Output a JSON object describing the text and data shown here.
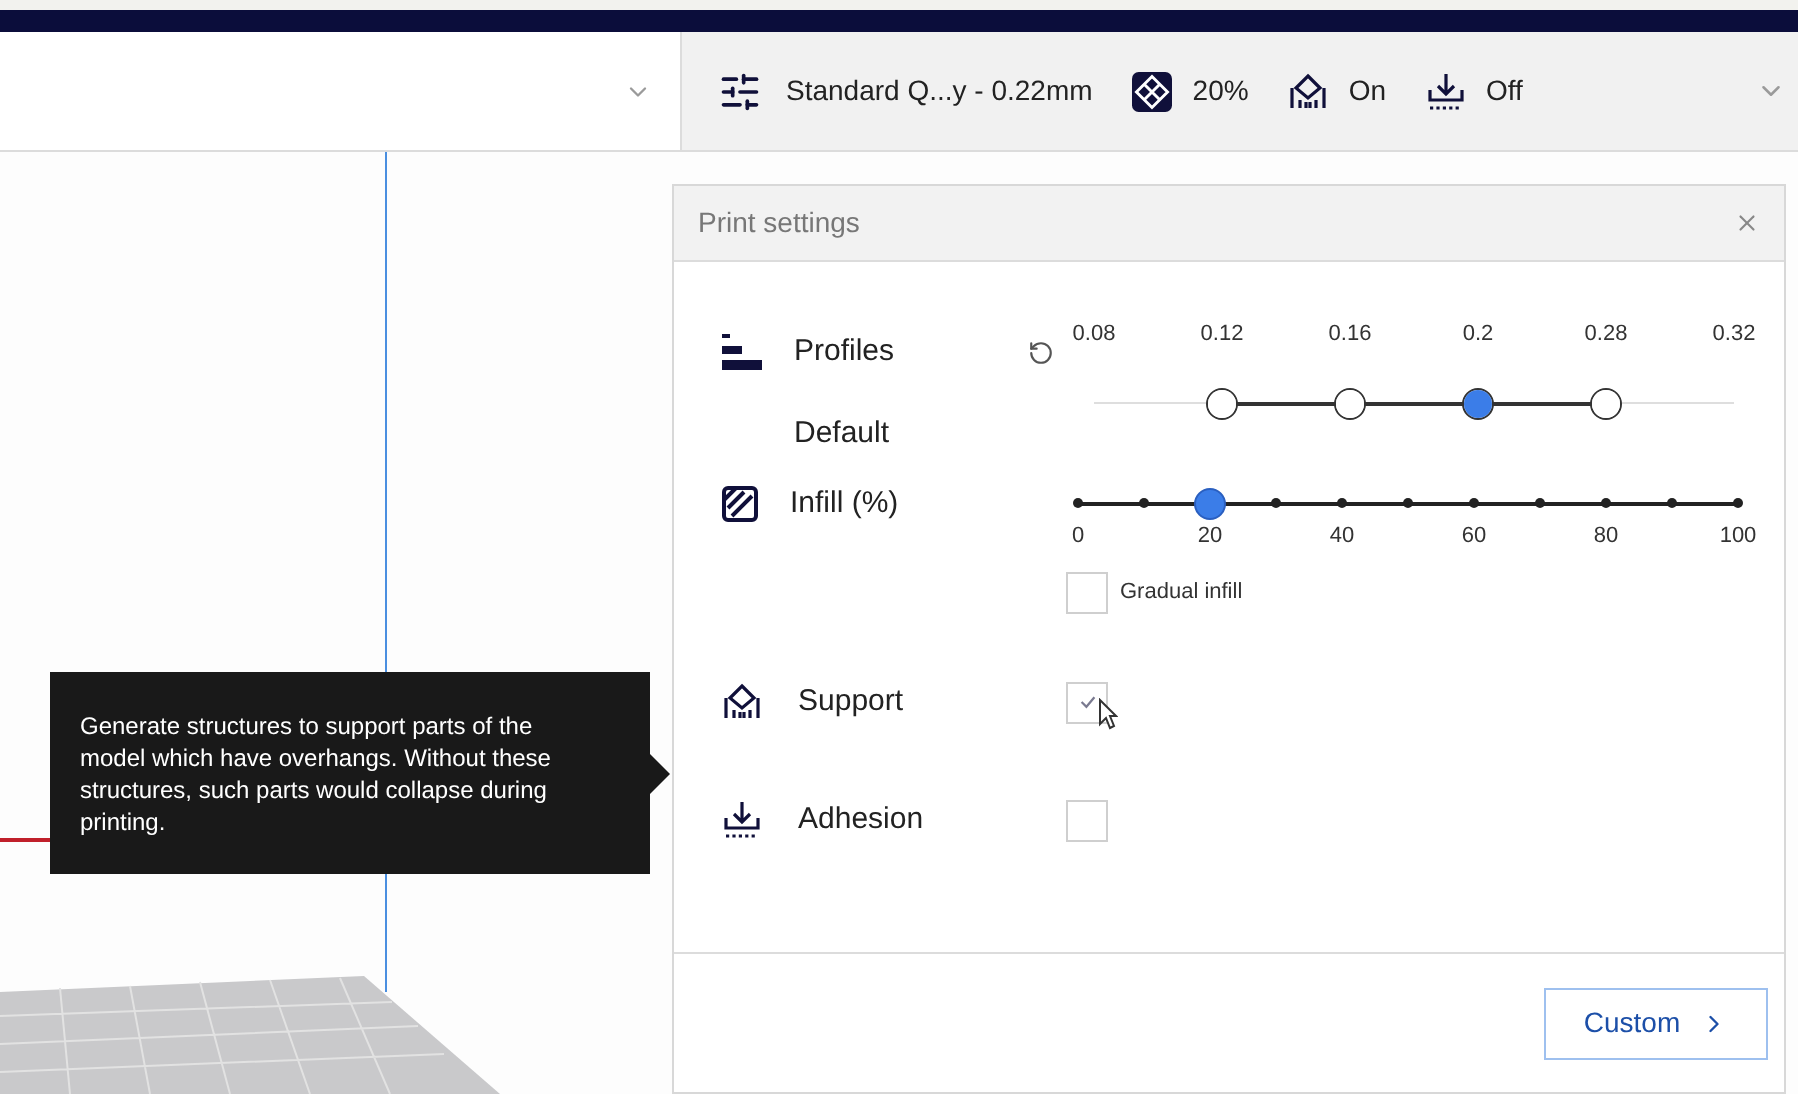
{
  "print_summary": [
    {
      "kind": "profile",
      "text": "Standard Q...y - 0.22mm"
    },
    {
      "kind": "infill",
      "text": "20%"
    },
    {
      "kind": "support",
      "text": "On"
    },
    {
      "kind": "adhesion",
      "text": "Off"
    }
  ],
  "panel": {
    "title": "Print settings",
    "profiles": {
      "label": "Profiles",
      "sublabel": "Default",
      "options": [
        {
          "label": "0.08",
          "available": false
        },
        {
          "label": "0.12",
          "available": true,
          "selected": false
        },
        {
          "label": "0.16",
          "available": true,
          "selected": false
        },
        {
          "label": "0.2",
          "available": true,
          "selected": true
        },
        {
          "label": "0.28",
          "available": true,
          "selected": false
        },
        {
          "label": "0.32",
          "available": false
        }
      ]
    },
    "infill": {
      "label": "Infill (%)",
      "level": 0.2,
      "ticks": [
        "0",
        "20",
        "40",
        "60",
        "80",
        "100"
      ],
      "gradual": {
        "label": "Gradual infill",
        "checked": false
      }
    },
    "support": {
      "label": "Support",
      "checked": true
    },
    "adhesion": {
      "label": "Adhesion",
      "checked": false
    },
    "custom_button": "Custom"
  },
  "tooltip": "Generate structures to support parts of the model which have overhangs. Without these structures, such parts would collapse during printing."
}
